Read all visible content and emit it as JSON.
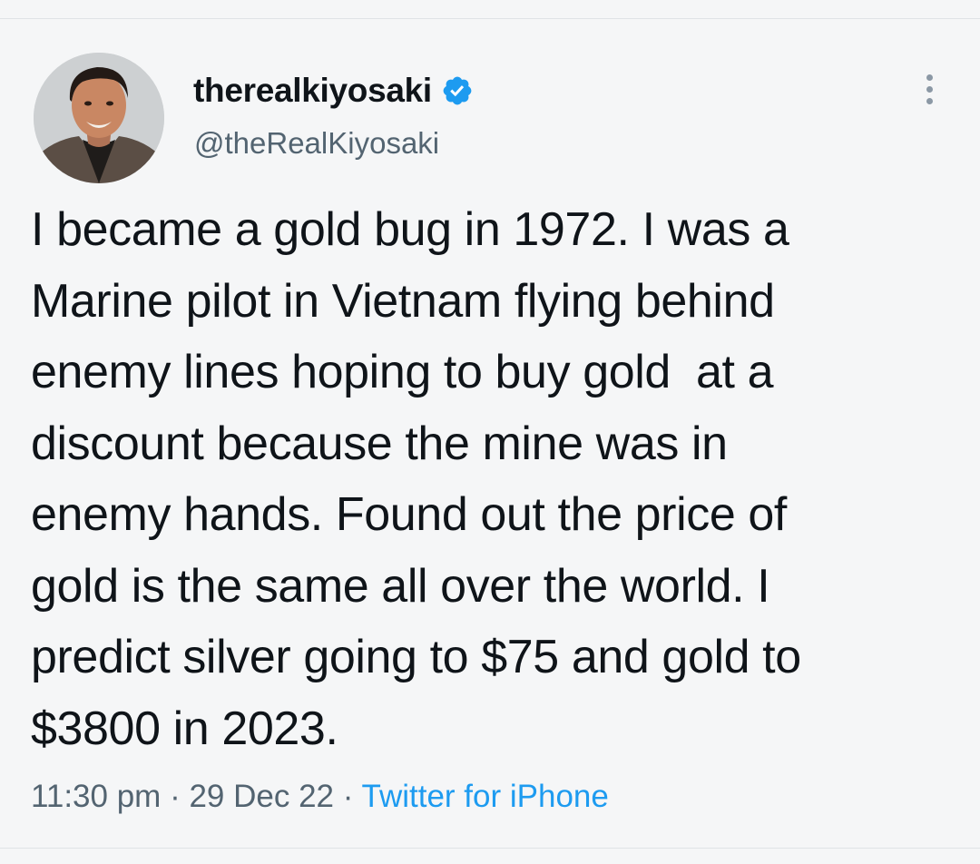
{
  "tweet": {
    "display_name": "therealkiyosaki",
    "handle": "@theRealKiyosaki",
    "verified_icon": "verified-badge-icon",
    "more_icon": "more-vertical-icon",
    "avatar_icon": "profile-photo",
    "text_lines": [
      "I became a gold bug in 1972. I was a",
      "Marine pilot in Vietnam flying behind",
      "enemy lines hoping to buy gold  at a",
      "discount because the mine was in",
      "enemy hands. Found out the price of",
      "gold is the same all over the world. I",
      "predict silver going to $75 and gold to",
      "$3800 in 2023."
    ],
    "time": "11:30 pm",
    "separator": " · ",
    "date": "29 Dec 22",
    "source": "Twitter for iPhone"
  },
  "colors": {
    "background": "#f5f6f7",
    "text": "#0f1419",
    "secondary": "#536471",
    "accent": "#1d9bf0"
  }
}
